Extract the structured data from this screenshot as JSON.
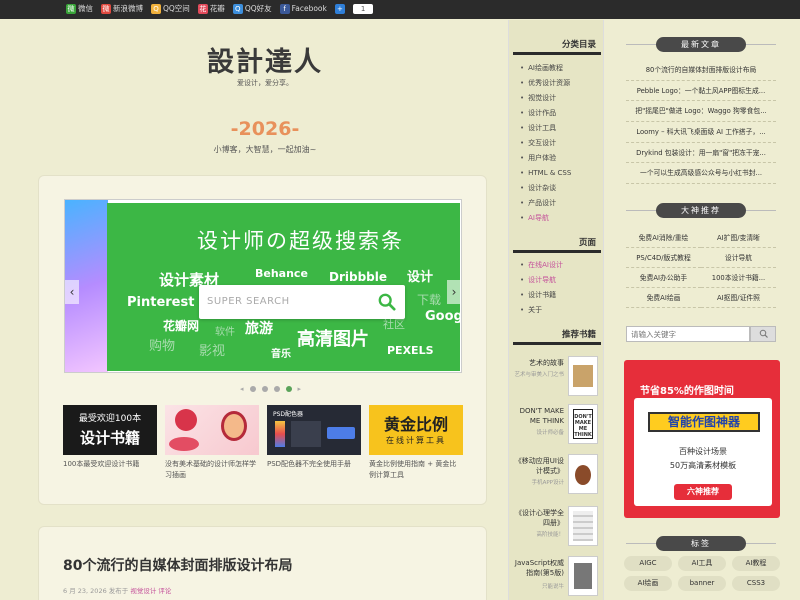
{
  "topbar": {
    "links": [
      {
        "label": "微信",
        "icon": "wechat-icon",
        "color": "#3aa53a",
        "glyph": "微"
      },
      {
        "label": "新浪微博",
        "icon": "weibo-icon",
        "color": "#e04a3f",
        "glyph": "微"
      },
      {
        "label": "QQ空间",
        "icon": "qzone-icon",
        "color": "#f1b13c",
        "glyph": "Q"
      },
      {
        "label": "花瓣",
        "icon": "huaban-icon",
        "color": "#e24a5a",
        "glyph": "花"
      },
      {
        "label": "QQ好友",
        "icon": "qq-icon",
        "color": "#3d8fdc",
        "glyph": "Q"
      },
      {
        "label": "Facebook",
        "icon": "facebook-icon",
        "color": "#3b5998",
        "glyph": "f"
      },
      {
        "label": "",
        "icon": "plus-share-icon",
        "color": "#2f7fd8",
        "glyph": "+"
      }
    ],
    "count": "1"
  },
  "header": {
    "logo": "設計達人",
    "slogan": "爱设计，爱分享。",
    "year": "-2026-",
    "year_sub": "小博客，大智慧，一起加油~"
  },
  "slider": {
    "headline": "设计师の超级搜索条",
    "search_placeholder": "SUPER SEARCH",
    "words": [
      "设计素材",
      "Behance",
      "Dribbble",
      "设计",
      "Pinterest",
      "下载",
      "花瓣网",
      "软件",
      "旅游",
      "高清图片",
      "社区",
      "Goog",
      "购物",
      "影视",
      "音乐",
      "PEXELS"
    ],
    "dots": 4,
    "active_dot": 3
  },
  "thumbs": [
    {
      "caption": "100本最受欢迎设计书籍",
      "line1": "最受欢迎100本",
      "line2": "设计书籍"
    },
    {
      "caption": "没有美术基础的设计师怎样学习插画"
    },
    {
      "caption": "PSD配色器不完全使用手册",
      "line1": "PSD配色器"
    },
    {
      "caption": "黄金比例使用指南 + 黄金比例计算工具",
      "line1": "黄金比例",
      "line2": "在线计算工具"
    }
  ],
  "post": {
    "title": "80个流行的自媒体封面排版设计布局",
    "meta": "6 月 23, 2026 发布于",
    "tags": "视觉设计  评论"
  },
  "middle": {
    "categories_title": "分类目录",
    "categories": [
      "AI绘画教程",
      "优秀设计资源",
      "视觉设计",
      "设计作品",
      "设计工具",
      "交互设计",
      "用户体验",
      "HTML & CSS",
      "设计杂谈",
      "产品设计",
      "AI导航"
    ],
    "pages_title": "页面",
    "pages": [
      "在线AI设计",
      "设计导航",
      "设计书籍",
      "关于"
    ],
    "books_title": "推荐书籍",
    "books": [
      {
        "title": "艺术的故事",
        "sub": "艺术与审美入门之书"
      },
      {
        "title": "DON'T MAKE ME THINK",
        "sub": "设计师必备",
        "cover_text": "DON'T MAKE ME THINK"
      },
      {
        "title": "《移动应用UI设计模式》",
        "sub": "手机APP设计"
      },
      {
        "title": "《设计心理学全四册》",
        "sub": "高阶技能！"
      },
      {
        "title": "JavaScript权威指南(第5版)",
        "sub": "只能说牛"
      }
    ]
  },
  "right": {
    "news_title": "最新文章",
    "news": [
      "80个流行的自媒体封面排版设计布局",
      "Pebble Logo：一个黏土风APP图标生成...",
      "把\"摇尾巴\"做进 Logo：Waggo 狗零食包...",
      "Loomy – 科大讯飞桌面级 AI 工作搭子，...",
      "Drykind 包装设计：用一扇\"窗\"把冻干宠...",
      "一个可以生成高级感公众号与小红书封..."
    ],
    "picks_title": "大神推荐",
    "picks": [
      "免费AI消除/重绘",
      "AI扩图/变清晰",
      "PS/C4D/版式教程",
      "设计导航",
      "免费AI办公助手",
      "100本设计书籍...",
      "免费AI绘画",
      "AI抠图/证件照"
    ],
    "search_placeholder": "请输入关键字",
    "ad": {
      "line1": "节省85%的作图时间",
      "title": "智能作图神器",
      "l1": "百种设计场景",
      "l2": "50万高清素材模板",
      "btn": "六神推荐"
    },
    "tags_title": "标签",
    "tags": [
      "AIGC",
      "AI工具",
      "AI教程",
      "AI绘画",
      "banner",
      "CSS3"
    ]
  }
}
